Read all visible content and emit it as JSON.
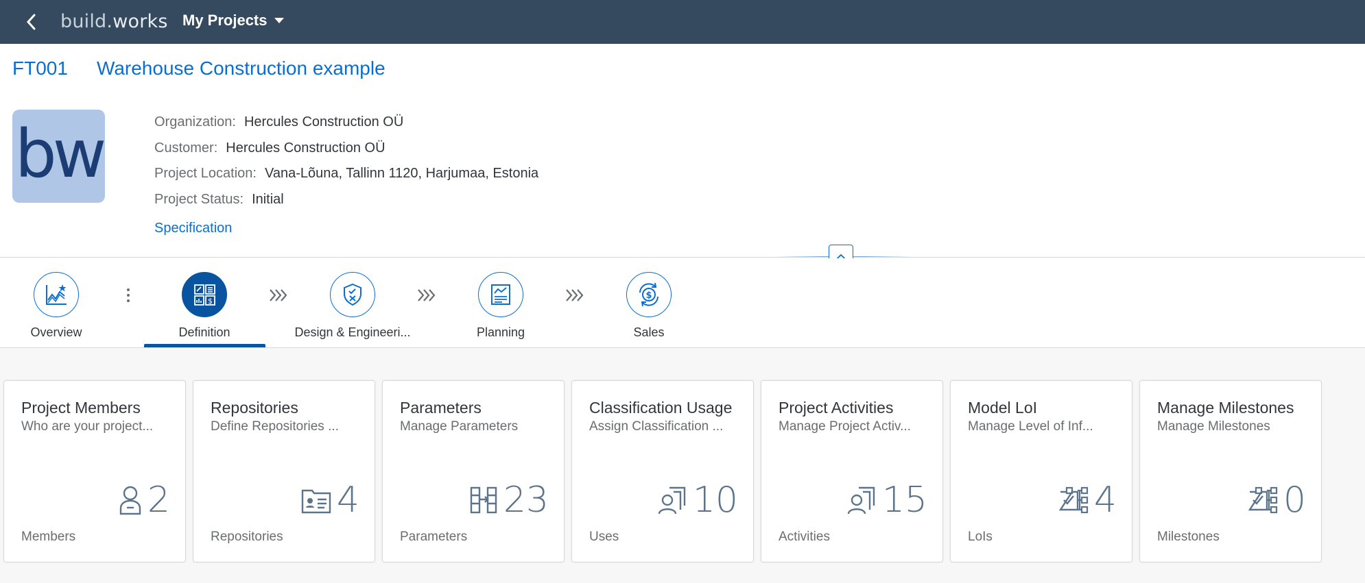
{
  "shell": {
    "logo_part1": "build.",
    "logo_part2": "works",
    "menu_title": "My Projects"
  },
  "header": {
    "project_id": "FT001",
    "project_name": "Warehouse Construction example",
    "avatar_text": "bw",
    "attributes": [
      {
        "label": "Organization:",
        "value": "Hercules Construction OÜ"
      },
      {
        "label": "Customer:",
        "value": "Hercules Construction OÜ"
      },
      {
        "label": "Project Location:",
        "value": "Vana-Lõuna, Tallinn 1120, Harjumaa, Estonia"
      },
      {
        "label": "Project Status:",
        "value": "Initial"
      }
    ],
    "link_label": "Specification"
  },
  "nav": {
    "items": [
      {
        "label": "Overview",
        "icon": "overview-chart-icon"
      },
      {
        "label": "Definition",
        "icon": "definition-icon"
      },
      {
        "label": "Design & Engineeri...",
        "icon": "shield-icon"
      },
      {
        "label": "Planning",
        "icon": "planning-icon"
      },
      {
        "label": "Sales",
        "icon": "sales-icon"
      }
    ],
    "active": "Definition"
  },
  "tiles": [
    {
      "title": "Project Members",
      "subtitle": "Who are your project...",
      "value": "2",
      "footer": "Members",
      "icon": "member-icon"
    },
    {
      "title": "Repositories",
      "subtitle": "Define Repositories ...",
      "value": "4",
      "footer": "Repositories",
      "icon": "repository-card-icon"
    },
    {
      "title": "Parameters",
      "subtitle": "Manage Parameters",
      "value": "23",
      "footer": "Parameters",
      "icon": "parameters-icon"
    },
    {
      "title": "Classification Usage",
      "subtitle": "Assign Classification ...",
      "value": "10",
      "footer": "Uses",
      "icon": "user-copy-icon"
    },
    {
      "title": "Project Activities",
      "subtitle": "Manage Project Activ...",
      "value": "15",
      "footer": "Activities",
      "icon": "user-copy-icon"
    },
    {
      "title": "Model LoI",
      "subtitle": "Manage Level of Inf...",
      "value": "4",
      "footer": "LoIs",
      "icon": "checklist-tree-icon"
    },
    {
      "title": "Manage Milestones",
      "subtitle": "Manage Milestones",
      "value": "0",
      "footer": "Milestones",
      "icon": "checklist-tree-icon"
    }
  ],
  "colors": {
    "shell": "#354a5f",
    "accent": "#0a6ed1",
    "active": "#0854a0",
    "kpi": "#5b738b"
  }
}
